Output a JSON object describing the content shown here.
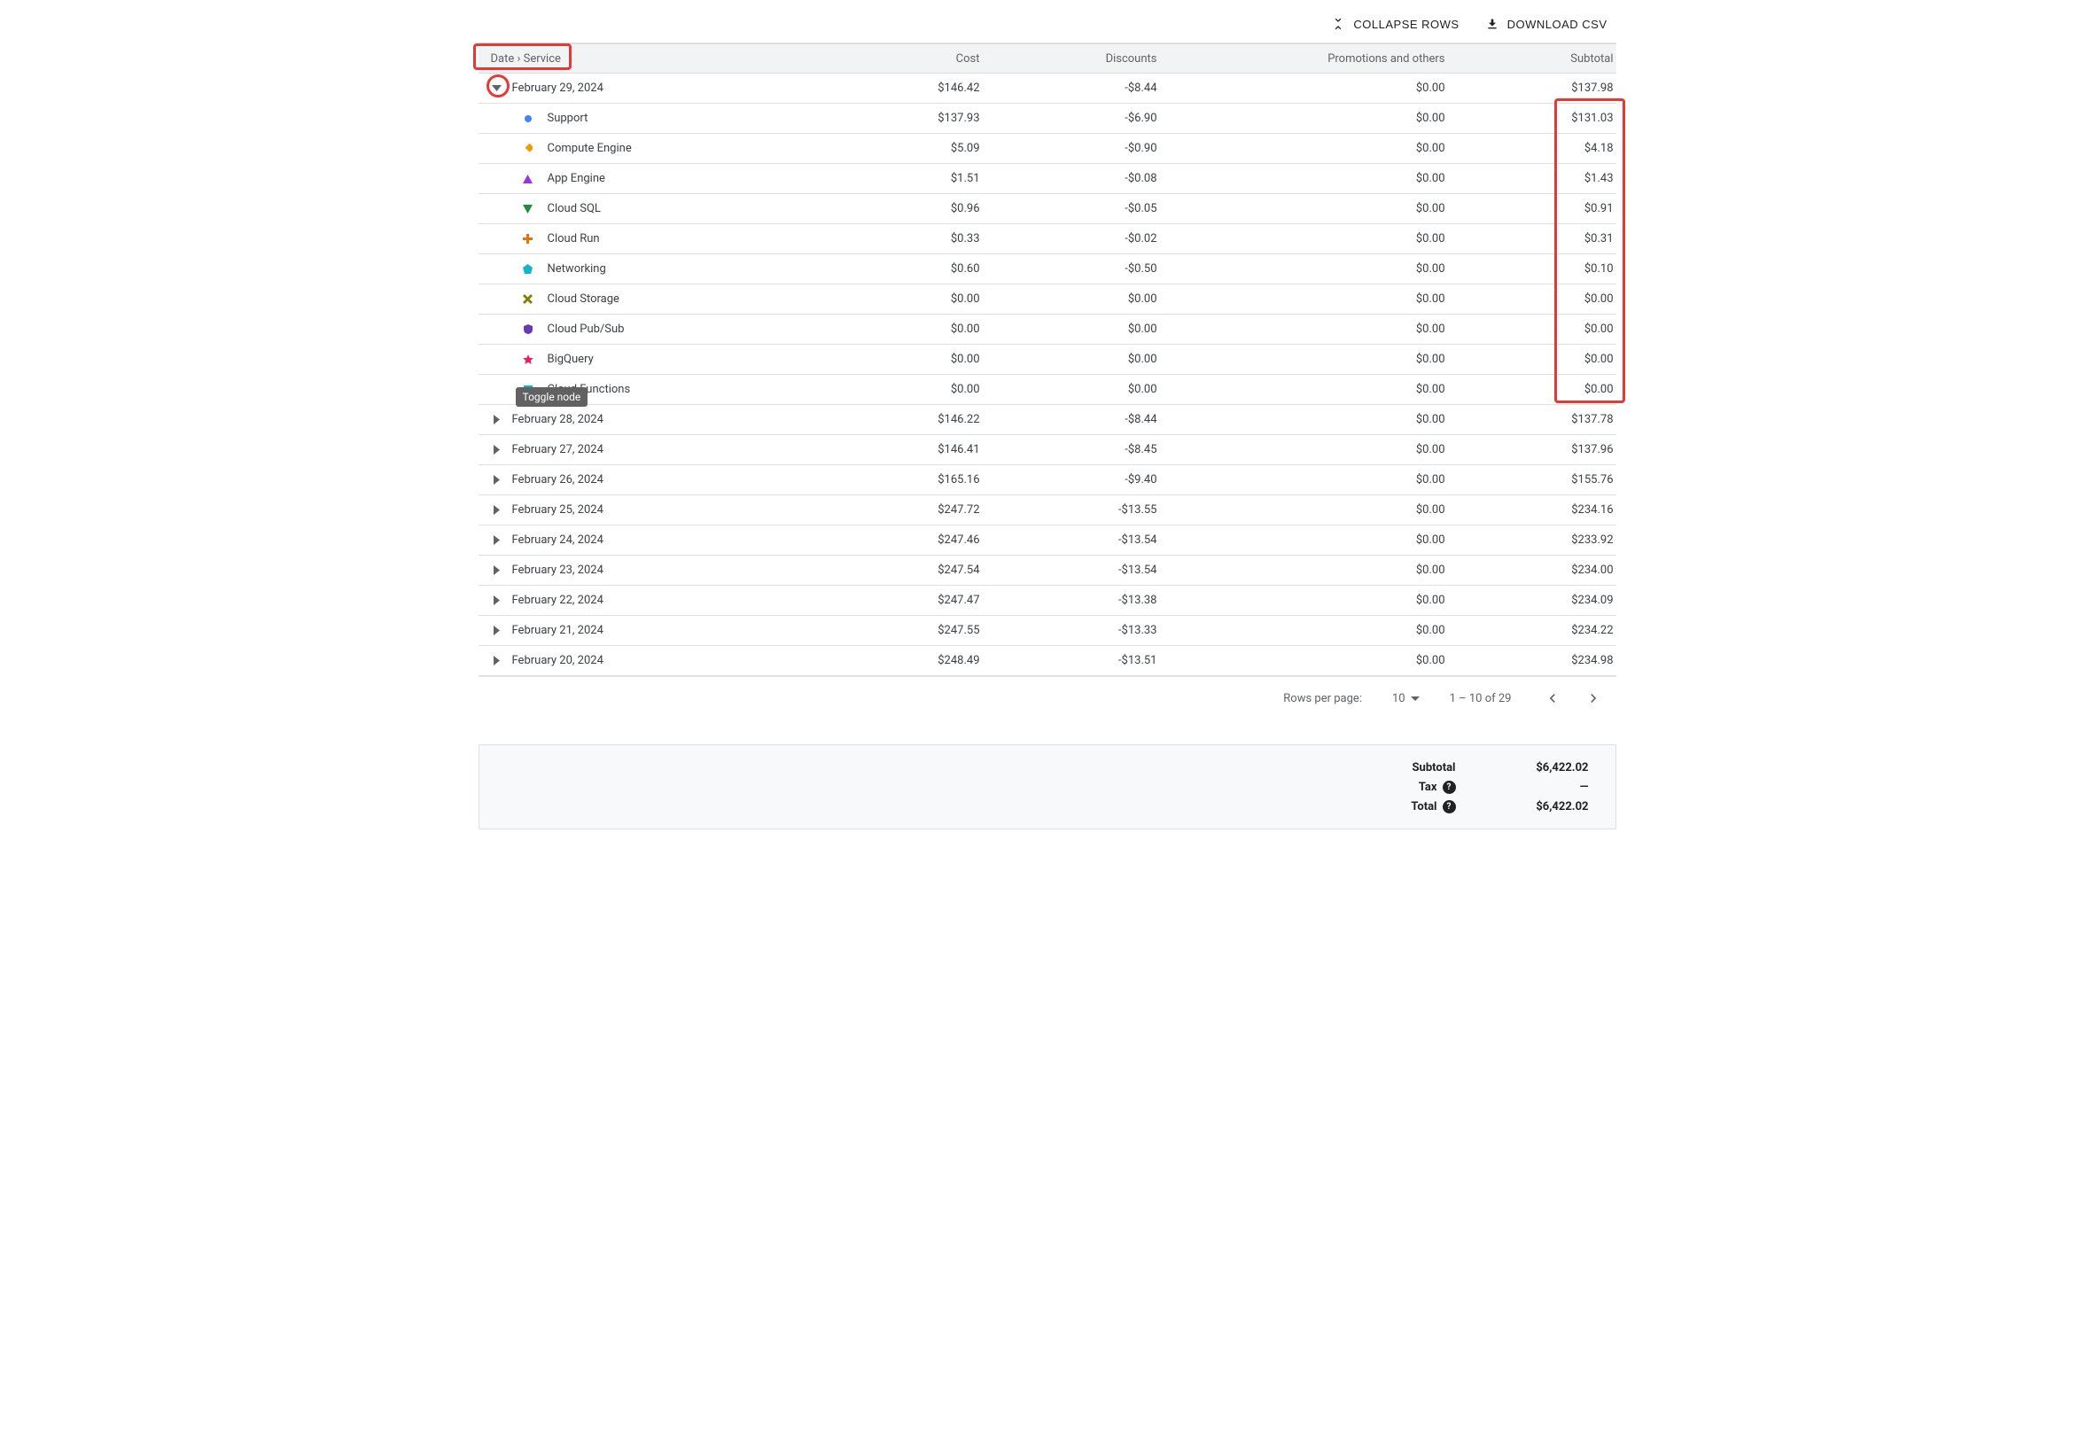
{
  "toolbar": {
    "collapse_label": "COLLAPSE ROWS",
    "download_label": "DOWNLOAD CSV"
  },
  "columns": {
    "c1": "Date › Service",
    "c2": "Cost",
    "c3": "Discounts",
    "c4": "Promotions and others",
    "c5": "Subtotal"
  },
  "tooltip": "Toggle node",
  "rows": [
    {
      "type": "parent",
      "expanded": true,
      "date": "February 29, 2024",
      "cost": "$146.42",
      "discounts": "-$8.44",
      "promo": "$0.00",
      "subtotal": "$137.98",
      "children": [
        {
          "marker": "circle",
          "color": "#4285f4",
          "name": "Support",
          "cost": "$137.93",
          "discounts": "-$6.90",
          "promo": "$0.00",
          "subtotal": "$131.03"
        },
        {
          "marker": "diamond",
          "color": "#f29900",
          "name": "Compute Engine",
          "cost": "$5.09",
          "discounts": "-$0.90",
          "promo": "$0.00",
          "subtotal": "$4.18"
        },
        {
          "marker": "triangle-up",
          "color": "#9334e6",
          "name": "App Engine",
          "cost": "$1.51",
          "discounts": "-$0.08",
          "promo": "$0.00",
          "subtotal": "$1.43"
        },
        {
          "marker": "triangle-down",
          "color": "#1e8e3e",
          "name": "Cloud SQL",
          "cost": "$0.96",
          "discounts": "-$0.05",
          "promo": "$0.00",
          "subtotal": "$0.91"
        },
        {
          "marker": "plus",
          "color": "#e8710a",
          "name": "Cloud Run",
          "cost": "$0.33",
          "discounts": "-$0.02",
          "promo": "$0.00",
          "subtotal": "$0.31"
        },
        {
          "marker": "pentagon",
          "color": "#12b5cb",
          "name": "Networking",
          "cost": "$0.60",
          "discounts": "-$0.50",
          "promo": "$0.00",
          "subtotal": "$0.10"
        },
        {
          "marker": "x",
          "color": "#808000",
          "name": "Cloud Storage",
          "cost": "$0.00",
          "discounts": "$0.00",
          "promo": "$0.00",
          "subtotal": "$0.00"
        },
        {
          "marker": "shield",
          "color": "#673ab7",
          "name": "Cloud Pub/Sub",
          "cost": "$0.00",
          "discounts": "$0.00",
          "promo": "$0.00",
          "subtotal": "$0.00"
        },
        {
          "marker": "star",
          "color": "#e91e63",
          "name": "BigQuery",
          "cost": "$0.00",
          "discounts": "$0.00",
          "promo": "$0.00",
          "subtotal": "$0.00"
        },
        {
          "marker": "square",
          "color": "#00bcd4",
          "name": "Cloud Functions",
          "cost": "$0.00",
          "discounts": "$0.00",
          "promo": "$0.00",
          "subtotal": "$0.00"
        }
      ]
    },
    {
      "type": "parent",
      "expanded": false,
      "date": "February 28, 2024",
      "cost": "$146.22",
      "discounts": "-$8.44",
      "promo": "$0.00",
      "subtotal": "$137.78"
    },
    {
      "type": "parent",
      "expanded": false,
      "date": "February 27, 2024",
      "cost": "$146.41",
      "discounts": "-$8.45",
      "promo": "$0.00",
      "subtotal": "$137.96"
    },
    {
      "type": "parent",
      "expanded": false,
      "date": "February 26, 2024",
      "cost": "$165.16",
      "discounts": "-$9.40",
      "promo": "$0.00",
      "subtotal": "$155.76"
    },
    {
      "type": "parent",
      "expanded": false,
      "date": "February 25, 2024",
      "cost": "$247.72",
      "discounts": "-$13.55",
      "promo": "$0.00",
      "subtotal": "$234.16"
    },
    {
      "type": "parent",
      "expanded": false,
      "date": "February 24, 2024",
      "cost": "$247.46",
      "discounts": "-$13.54",
      "promo": "$0.00",
      "subtotal": "$233.92"
    },
    {
      "type": "parent",
      "expanded": false,
      "date": "February 23, 2024",
      "cost": "$247.54",
      "discounts": "-$13.54",
      "promo": "$0.00",
      "subtotal": "$234.00"
    },
    {
      "type": "parent",
      "expanded": false,
      "date": "February 22, 2024",
      "cost": "$247.47",
      "discounts": "-$13.38",
      "promo": "$0.00",
      "subtotal": "$234.09"
    },
    {
      "type": "parent",
      "expanded": false,
      "date": "February 21, 2024",
      "cost": "$247.55",
      "discounts": "-$13.33",
      "promo": "$0.00",
      "subtotal": "$234.22"
    },
    {
      "type": "parent",
      "expanded": false,
      "date": "February 20, 2024",
      "cost": "$248.49",
      "discounts": "-$13.51",
      "promo": "$0.00",
      "subtotal": "$234.98"
    }
  ],
  "pagination": {
    "rows_label": "Rows per page:",
    "rows_value": "10",
    "range": "1 – 10 of 29"
  },
  "summary": {
    "subtotal_label": "Subtotal",
    "subtotal_value": "$6,422.02",
    "tax_label": "Tax",
    "tax_value": "—",
    "total_label": "Total",
    "total_value": "$6,422.02"
  }
}
